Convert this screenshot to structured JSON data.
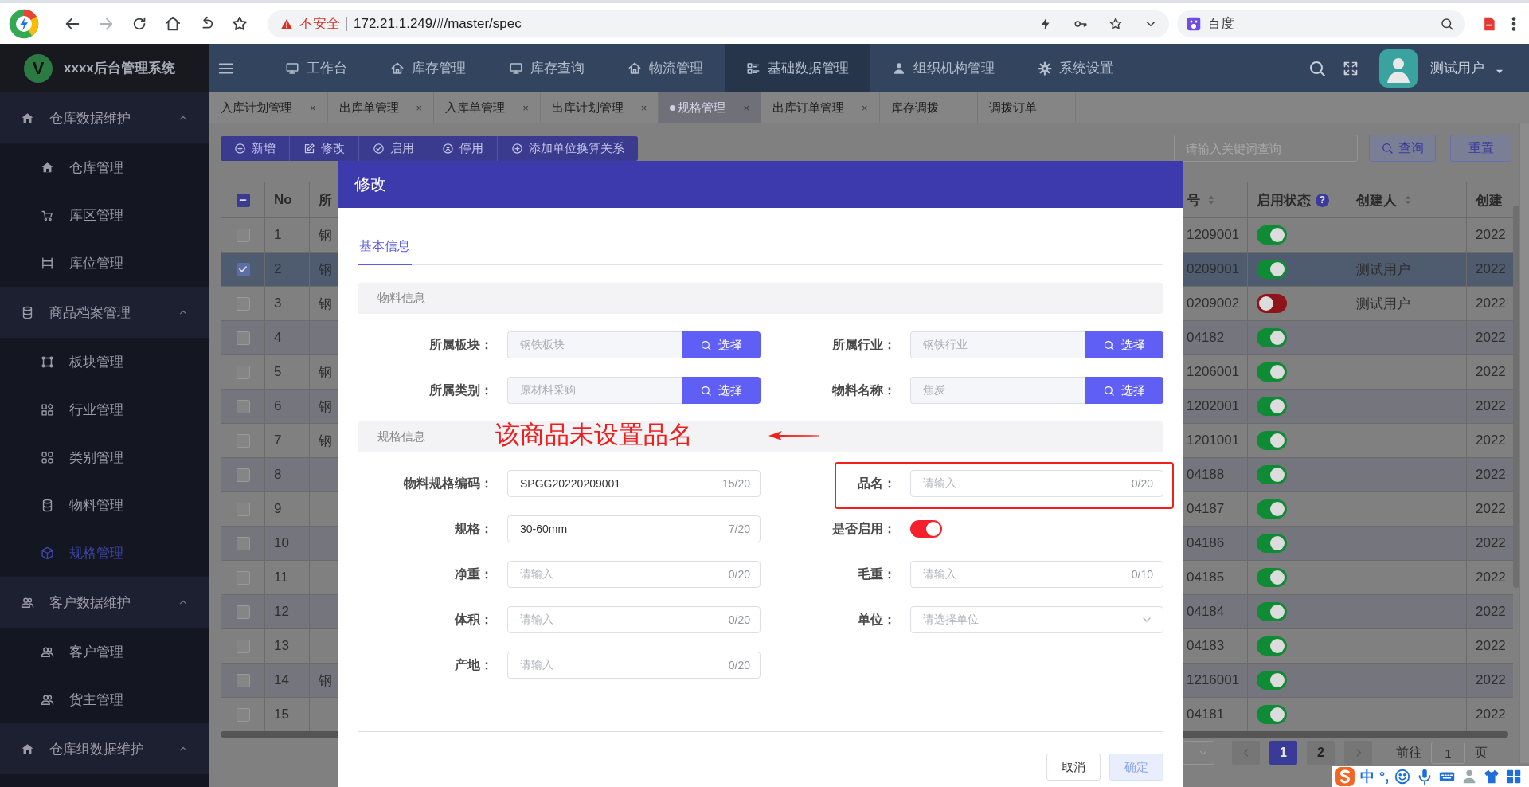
{
  "browser": {
    "security_label": "不安全",
    "url": "172.21.1.249/#/master/spec",
    "search_placeholder": "百度"
  },
  "app": {
    "logo_letter": "V",
    "title": "xxxx后台管理系统",
    "user": "测试用户"
  },
  "nav": [
    {
      "label": "工作台",
      "selected": false
    },
    {
      "label": "库存管理",
      "selected": false
    },
    {
      "label": "库存查询",
      "selected": false
    },
    {
      "label": "物流管理",
      "selected": false
    },
    {
      "label": "基础数据管理",
      "selected": true
    },
    {
      "label": "组织机构管理",
      "selected": false
    },
    {
      "label": "系统设置",
      "selected": false
    }
  ],
  "sidebar": [
    {
      "label": "仓库数据维护",
      "expanded": true,
      "children": [
        {
          "label": "仓库管理",
          "selected": false
        },
        {
          "label": "库区管理",
          "selected": false
        },
        {
          "label": "库位管理",
          "selected": false
        }
      ]
    },
    {
      "label": "商品档案管理",
      "expanded": true,
      "children": [
        {
          "label": "板块管理",
          "selected": false
        },
        {
          "label": "行业管理",
          "selected": false
        },
        {
          "label": "类别管理",
          "selected": false
        },
        {
          "label": "物料管理",
          "selected": false
        },
        {
          "label": "规格管理",
          "selected": true
        }
      ]
    },
    {
      "label": "客户数据维护",
      "expanded": true,
      "children": [
        {
          "label": "客户管理",
          "selected": false
        },
        {
          "label": "货主管理",
          "selected": false
        }
      ]
    },
    {
      "label": "仓库组数据维护",
      "expanded": true
    }
  ],
  "page_tabs": [
    {
      "label": "入库计划管理",
      "selected": false,
      "close": "×"
    },
    {
      "label": "出库单管理",
      "selected": false,
      "close": "×"
    },
    {
      "label": "入库单管理",
      "selected": false,
      "close": "×"
    },
    {
      "label": "出库计划管理",
      "selected": false,
      "close": "×"
    },
    {
      "label": "规格管理",
      "selected": true,
      "close": "×"
    },
    {
      "label": "出库订单管理",
      "selected": false,
      "close": "×"
    },
    {
      "label": "库存调拨",
      "selected": false
    },
    {
      "label": "调拨订单",
      "selected": false
    }
  ],
  "toolbar": {
    "buttons": [
      "新增",
      "修改",
      "启用",
      "停用",
      "添加单位换算关系"
    ],
    "search_placeholder": "请输入关键词查询",
    "query_button": "查询",
    "reset_button": "重置"
  },
  "table": {
    "select_all": {
      "indeterminate": true
    },
    "columns": [
      {
        "kind": "text",
        "label": "No",
        "sortable": false
      },
      {
        "kind": "text",
        "label": "所",
        "sortable": false
      },
      {
        "kind": "text",
        "label": "号",
        "sortable": true
      },
      {
        "kind": "switch",
        "label": "启用状态",
        "sortable": false,
        "hint": "?"
      },
      {
        "kind": "text",
        "label": "创建人",
        "sortable": true
      },
      {
        "kind": "text",
        "label": "创建",
        "sortable": false
      }
    ],
    "rows": [
      {
        "selected": false,
        "no": "1",
        "column_3": "钢",
        "column_4": "1209001",
        "enabled": true,
        "created": "2022"
      },
      {
        "selected": true,
        "no": "2",
        "column_3": "钢",
        "column_4": "0209001",
        "enabled": true,
        "creator": "测试用户",
        "created": "2022"
      },
      {
        "selected": false,
        "no": "3",
        "column_3": "钢",
        "column_4": "0209002",
        "enabled": false,
        "creator": "测试用户",
        "created": "2022"
      },
      {
        "selected": false,
        "no": "4",
        "column_4": "04182",
        "enabled": true,
        "created": "2022"
      },
      {
        "selected": false,
        "no": "5",
        "column_3": "钢",
        "column_4": "1206001",
        "enabled": true,
        "created": "2022"
      },
      {
        "selected": false,
        "no": "6",
        "column_3": "钢",
        "column_4": "1202001",
        "enabled": true,
        "created": "2022"
      },
      {
        "selected": false,
        "no": "7",
        "column_3": "钢",
        "column_4": "1201001",
        "enabled": true,
        "created": "2022"
      },
      {
        "selected": false,
        "no": "8",
        "column_4": "04188",
        "enabled": true,
        "created": "2022"
      },
      {
        "selected": false,
        "no": "9",
        "column_4": "04187",
        "enabled": true,
        "created": "2022"
      },
      {
        "selected": false,
        "no": "10",
        "column_4": "04186",
        "enabled": true,
        "created": "2022"
      },
      {
        "selected": false,
        "no": "11",
        "column_4": "04185",
        "enabled": true,
        "created": "2022"
      },
      {
        "selected": false,
        "no": "12",
        "column_4": "04184",
        "enabled": true,
        "created": "2022"
      },
      {
        "selected": false,
        "no": "13",
        "column_4": "04183",
        "enabled": true,
        "created": "2022"
      },
      {
        "selected": false,
        "no": "14",
        "column_3": "钢",
        "column_4": "1216001",
        "enabled": true,
        "created": "2022"
      },
      {
        "selected": false,
        "no": "15",
        "column_4": "04181",
        "enabled": true,
        "created": "2022"
      }
    ]
  },
  "pagination": {
    "pages": [
      {
        "label": "1",
        "selected": true
      },
      {
        "label": "2",
        "selected": false
      }
    ],
    "goto_label": "前往",
    "goto_value": "1",
    "page_suffix": "页"
  },
  "ime_bar": {
    "mode": "中",
    "punctuation": "°,"
  },
  "modal": {
    "title": "修改",
    "tabs": [
      {
        "label": "基本信息",
        "selected": true
      }
    ],
    "sections": [
      {
        "title": "物料信息",
        "fields": [
          {
            "kind": "picker",
            "label": "所属板块：",
            "value": "钢铁板块",
            "button": "选择",
            "disabled": true,
            "highlighted": false
          },
          {
            "kind": "picker",
            "label": "所属行业：",
            "value": "钢铁行业",
            "button": "选择",
            "disabled": true,
            "highlighted": false
          },
          {
            "kind": "picker",
            "label": "所属类别：",
            "value": "原材料采购",
            "button": "选择",
            "disabled": true,
            "highlighted": false
          },
          {
            "kind": "picker",
            "label": "物料名称：",
            "value": "焦炭",
            "button": "选择",
            "disabled": true,
            "highlighted": false
          }
        ]
      },
      {
        "title": "规格信息",
        "annotation": "该商品未设置品名",
        "fields": [
          {
            "kind": "input",
            "label": "物料规格编码：",
            "value": "SPGG20220209001",
            "count": "15/20",
            "highlighted": false
          },
          {
            "kind": "input",
            "label": "品名：",
            "placeholder": "请输入",
            "count": "0/20",
            "highlighted": true
          },
          {
            "kind": "input",
            "label": "规格：",
            "value": "30-60mm",
            "count": "7/20",
            "highlighted": false
          },
          {
            "kind": "switch",
            "label": "是否启用：",
            "on": true,
            "highlighted": false
          },
          {
            "kind": "input",
            "label": "净重：",
            "placeholder": "请输入",
            "count": "0/20",
            "highlighted": false
          },
          {
            "kind": "input",
            "label": "毛重：",
            "placeholder": "请输入",
            "count": "0/10",
            "highlighted": false
          },
          {
            "kind": "input",
            "label": "体积：",
            "placeholder": "请输入",
            "count": "0/20",
            "highlighted": false
          },
          {
            "kind": "select",
            "label": "单位：",
            "placeholder": "请选择单位",
            "highlighted": false
          },
          {
            "kind": "input",
            "label": "产地：",
            "placeholder": "请输入",
            "count": "0/20",
            "highlighted": false
          }
        ]
      }
    ],
    "buttons": [
      {
        "label": "取消",
        "kind": "default",
        "disabled": false
      },
      {
        "label": "确定",
        "kind": "primary",
        "disabled": true
      }
    ]
  }
}
